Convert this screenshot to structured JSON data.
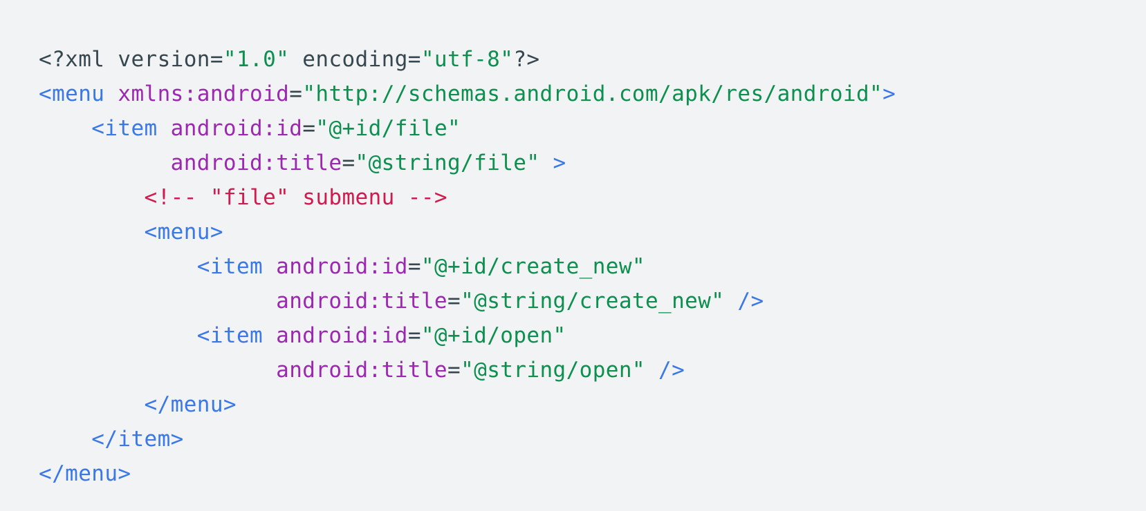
{
  "code": {
    "lines": [
      [
        {
          "t": "<?xml version=",
          "k": "pun"
        },
        {
          "t": "\"1.0\"",
          "k": "str"
        },
        {
          "t": " encoding=",
          "k": "pun"
        },
        {
          "t": "\"utf-8\"",
          "k": "str"
        },
        {
          "t": "?>",
          "k": "pun"
        }
      ],
      [
        {
          "t": "<menu",
          "k": "tag"
        },
        {
          "t": " ",
          "k": "pun"
        },
        {
          "t": "xmlns:android",
          "k": "attr"
        },
        {
          "t": "=",
          "k": "pun"
        },
        {
          "t": "\"http://schemas.android.com/apk/res/android\"",
          "k": "str"
        },
        {
          "t": ">",
          "k": "tag"
        }
      ],
      [
        {
          "t": "    ",
          "k": "pun"
        },
        {
          "t": "<item",
          "k": "tag"
        },
        {
          "t": " ",
          "k": "pun"
        },
        {
          "t": "android:id",
          "k": "attr"
        },
        {
          "t": "=",
          "k": "pun"
        },
        {
          "t": "\"@+id/file\"",
          "k": "str"
        }
      ],
      [
        {
          "t": "          ",
          "k": "pun"
        },
        {
          "t": "android:title",
          "k": "attr"
        },
        {
          "t": "=",
          "k": "pun"
        },
        {
          "t": "\"@string/file\"",
          "k": "str"
        },
        {
          "t": " ",
          "k": "pun"
        },
        {
          "t": ">",
          "k": "tag"
        }
      ],
      [
        {
          "t": "        ",
          "k": "pun"
        },
        {
          "t": "<!-- \"file\" submenu -->",
          "k": "com"
        }
      ],
      [
        {
          "t": "        ",
          "k": "pun"
        },
        {
          "t": "<menu>",
          "k": "tag"
        }
      ],
      [
        {
          "t": "            ",
          "k": "pun"
        },
        {
          "t": "<item",
          "k": "tag"
        },
        {
          "t": " ",
          "k": "pun"
        },
        {
          "t": "android:id",
          "k": "attr"
        },
        {
          "t": "=",
          "k": "pun"
        },
        {
          "t": "\"@+id/create_new\"",
          "k": "str"
        }
      ],
      [
        {
          "t": "                  ",
          "k": "pun"
        },
        {
          "t": "android:title",
          "k": "attr"
        },
        {
          "t": "=",
          "k": "pun"
        },
        {
          "t": "\"@string/create_new\"",
          "k": "str"
        },
        {
          "t": " ",
          "k": "pun"
        },
        {
          "t": "/>",
          "k": "tag"
        }
      ],
      [
        {
          "t": "            ",
          "k": "pun"
        },
        {
          "t": "<item",
          "k": "tag"
        },
        {
          "t": " ",
          "k": "pun"
        },
        {
          "t": "android:id",
          "k": "attr"
        },
        {
          "t": "=",
          "k": "pun"
        },
        {
          "t": "\"@+id/open\"",
          "k": "str"
        }
      ],
      [
        {
          "t": "                  ",
          "k": "pun"
        },
        {
          "t": "android:title",
          "k": "attr"
        },
        {
          "t": "=",
          "k": "pun"
        },
        {
          "t": "\"@string/open\"",
          "k": "str"
        },
        {
          "t": " ",
          "k": "pun"
        },
        {
          "t": "/>",
          "k": "tag"
        }
      ],
      [
        {
          "t": "        ",
          "k": "pun"
        },
        {
          "t": "</menu>",
          "k": "tag"
        }
      ],
      [
        {
          "t": "    ",
          "k": "pun"
        },
        {
          "t": "</item>",
          "k": "tag"
        }
      ],
      [
        {
          "t": "</menu>",
          "k": "tag"
        }
      ]
    ]
  }
}
